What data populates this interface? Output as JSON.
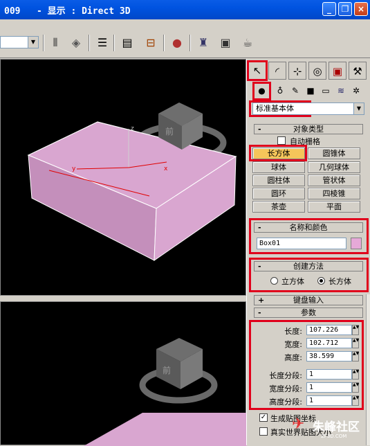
{
  "window": {
    "title": "009   - 显示 : Direct 3D"
  },
  "toolbar": {
    "selection_value": "",
    "icons": [
      "mirror-icon",
      "align-icon",
      "layer-manager-icon",
      "curve-editor-icon",
      "schematic-view-icon",
      "material-editor-icon",
      "render-setup-icon",
      "render-frame-icon",
      "quick-render-icon"
    ]
  },
  "command_panel": {
    "tabs": [
      "create-tab",
      "modify-tab",
      "hierarchy-tab",
      "motion-tab",
      "display-tab",
      "utilities-tab"
    ],
    "subtabs": [
      "geometry",
      "shapes",
      "lights",
      "cameras",
      "helpers",
      "space-warps",
      "systems"
    ],
    "category": "标准基本体",
    "object_type": {
      "header": "对象类型",
      "autogrid_label": "自动栅格",
      "buttons": [
        "长方体",
        "圆锥体",
        "球体",
        "几何球体",
        "圆柱体",
        "管状体",
        "圆环",
        "四棱锥",
        "茶壶",
        "平面"
      ],
      "active": "长方体"
    },
    "name_color": {
      "header": "名称和颜色",
      "name": "Box01",
      "color": "#e6a9d8"
    },
    "creation_method": {
      "header": "创建方法",
      "options": [
        "立方体",
        "长方体"
      ],
      "selected": "长方体"
    },
    "keyboard_entry": {
      "header": "键盘输入"
    },
    "parameters": {
      "header": "参数",
      "length_label": "长度:",
      "length": "107.226",
      "width_label": "宽度:",
      "width": "102.712",
      "height_label": "高度:",
      "height": "38.599",
      "length_segs_label": "长度分段:",
      "length_segs": "1",
      "width_segs_label": "宽度分段:",
      "width_segs": "1",
      "height_segs_label": "高度分段:",
      "height_segs": "1",
      "gen_mapping_label": "生成贴图坐标",
      "real_world_label": "真实世界贴图大小"
    }
  },
  "viewport": {
    "box_color": "#d9a6d0",
    "axis_x": "x",
    "axis_y": "y",
    "axis_z": "z",
    "cube_front": "前"
  },
  "watermark": {
    "text": "朱峰社区",
    "sub": "ZF3D.COM"
  },
  "colors": {
    "highlight_red": "#e0001b",
    "active_button": "#f5c55a"
  }
}
